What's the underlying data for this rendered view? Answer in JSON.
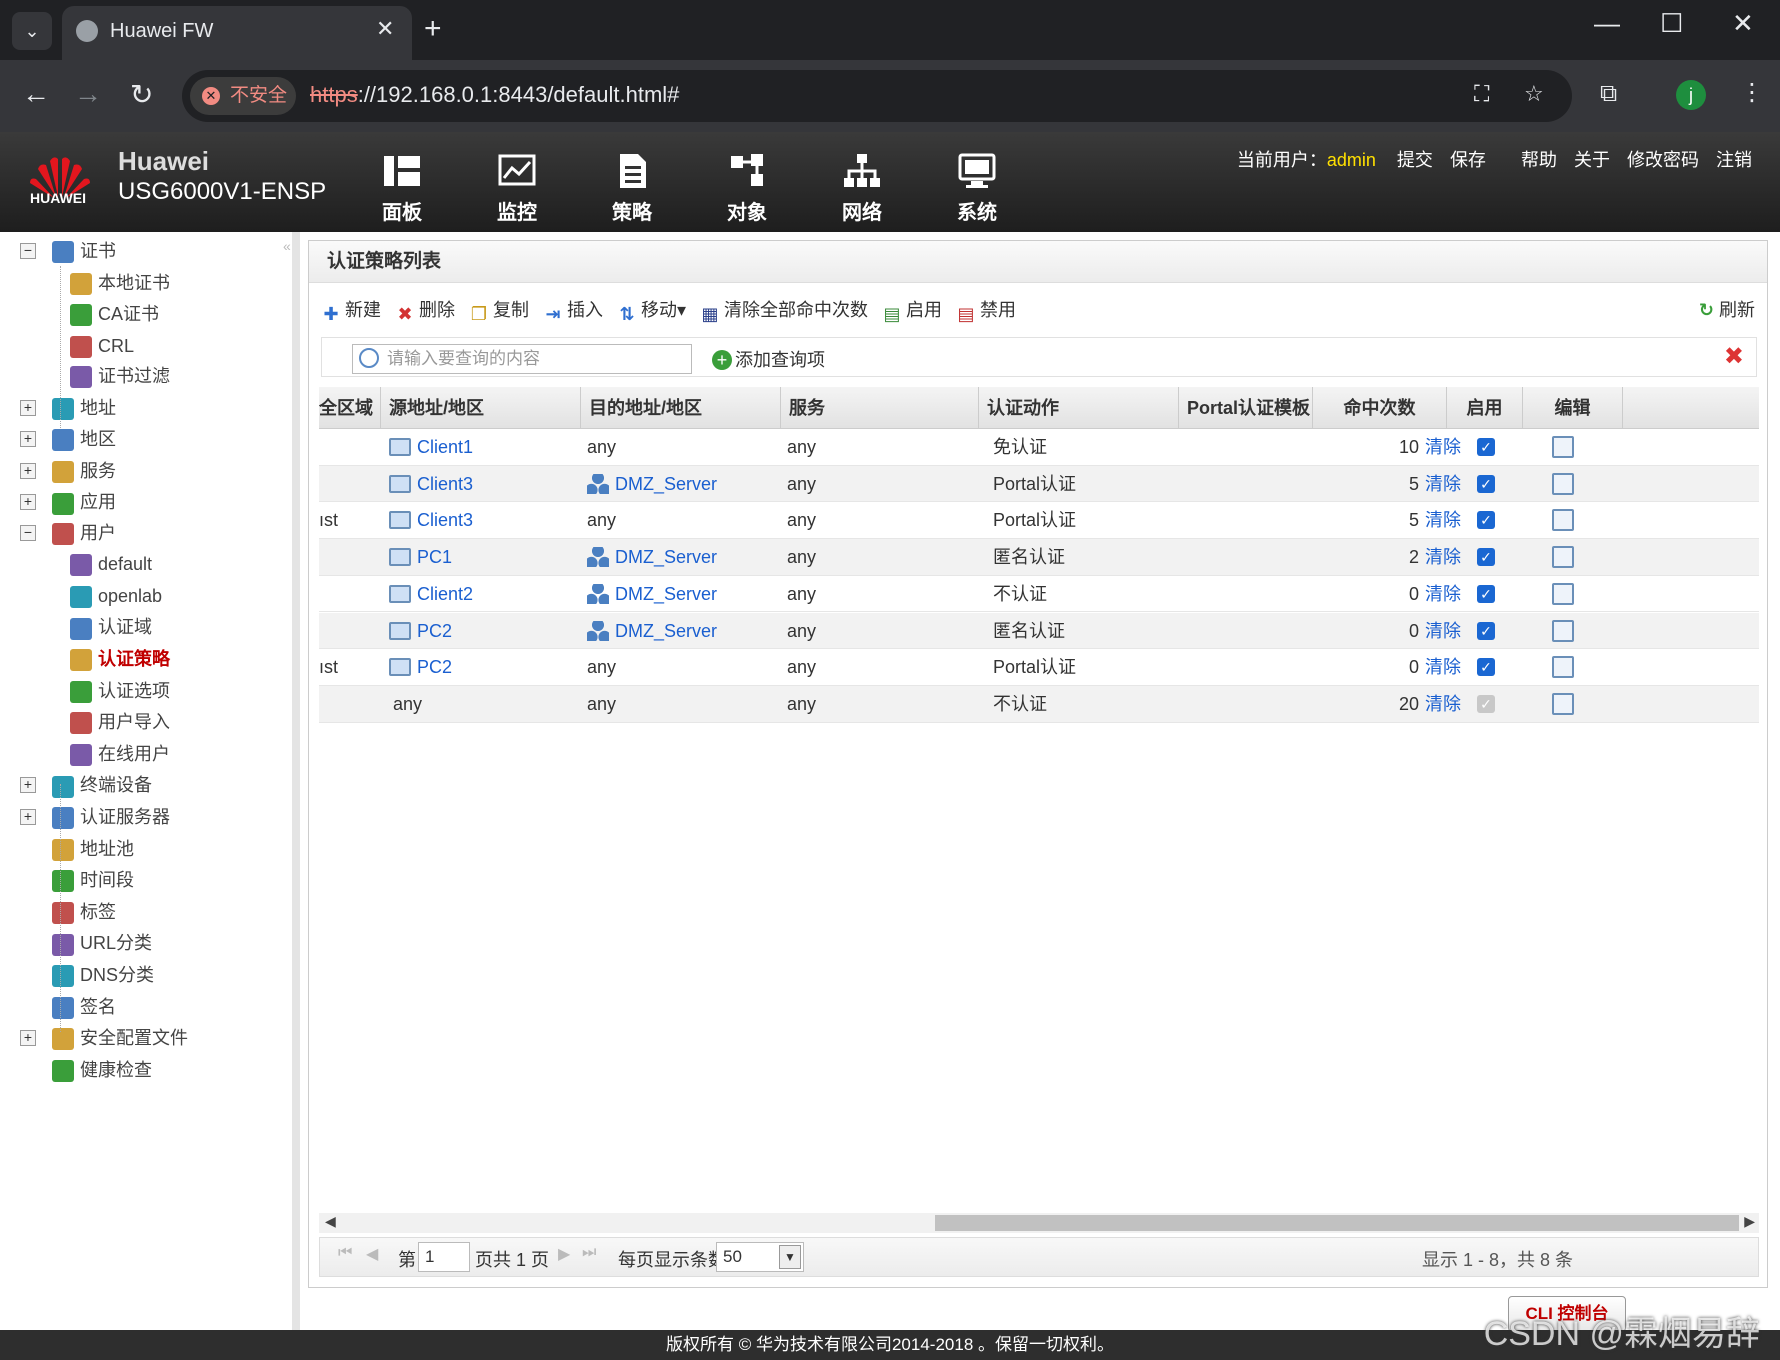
{
  "browser": {
    "tab_title": "Huawei FW",
    "tab_close": "✕",
    "new_tab": "+",
    "insecure_label": "不安全",
    "url_scheme": "https",
    "url_rest": "://192.168.0.1:8443/default.html#",
    "profile_initial": "j"
  },
  "header": {
    "brand_line1": "Huawei",
    "brand_line2": "USG6000V1-ENSP",
    "logo_text": "HUAWEI",
    "nav": [
      "面板",
      "监控",
      "策略",
      "对象",
      "网络",
      "系统"
    ],
    "user_label": "当前用户：",
    "user_name": "admin",
    "links": [
      "提交",
      "保存",
      "帮助",
      "关于",
      "修改密码",
      "注销"
    ]
  },
  "sidebar": {
    "items": [
      {
        "label": "证书",
        "icon": "certificate-icon",
        "level": 0,
        "expander": "−"
      },
      {
        "label": "本地证书",
        "icon": "local-cert-icon",
        "level": 1
      },
      {
        "label": "CA证书",
        "icon": "ca-cert-icon",
        "level": 1
      },
      {
        "label": "CRL",
        "icon": "crl-icon",
        "level": 1
      },
      {
        "label": "证书过滤",
        "icon": "cert-filter-icon",
        "level": 1
      },
      {
        "label": "地址",
        "icon": "address-icon",
        "level": 0,
        "expander": "+"
      },
      {
        "label": "地区",
        "icon": "region-icon",
        "level": 0,
        "expander": "+"
      },
      {
        "label": "服务",
        "icon": "service-icon",
        "level": 0,
        "expander": "+"
      },
      {
        "label": "应用",
        "icon": "application-icon",
        "level": 0,
        "expander": "+"
      },
      {
        "label": "用户",
        "icon": "user-icon",
        "level": 0,
        "expander": "−"
      },
      {
        "label": "default",
        "icon": "user-group-icon",
        "level": 1
      },
      {
        "label": "openlab",
        "icon": "user-group-icon",
        "level": 1
      },
      {
        "label": "认证域",
        "icon": "auth-domain-icon",
        "level": 1
      },
      {
        "label": "认证策略",
        "icon": "auth-policy-icon",
        "level": 1,
        "selected": true
      },
      {
        "label": "认证选项",
        "icon": "auth-option-icon",
        "level": 1
      },
      {
        "label": "用户导入",
        "icon": "user-import-icon",
        "level": 1
      },
      {
        "label": "在线用户",
        "icon": "online-user-icon",
        "level": 1
      },
      {
        "label": "终端设备",
        "icon": "terminal-device-icon",
        "level": 0,
        "expander": "+"
      },
      {
        "label": "认证服务器",
        "icon": "auth-server-icon",
        "level": 0,
        "expander": "+"
      },
      {
        "label": "地址池",
        "icon": "address-pool-icon",
        "level": 0
      },
      {
        "label": "时间段",
        "icon": "time-range-icon",
        "level": 0
      },
      {
        "label": "标签",
        "icon": "tag-icon",
        "level": 0
      },
      {
        "label": "URL分类",
        "icon": "url-category-icon",
        "level": 0
      },
      {
        "label": "DNS分类",
        "icon": "dns-category-icon",
        "level": 0
      },
      {
        "label": "签名",
        "icon": "signature-icon",
        "level": 0
      },
      {
        "label": "安全配置文件",
        "icon": "security-profile-icon",
        "level": 0,
        "expander": "+"
      },
      {
        "label": "健康检查",
        "icon": "health-check-icon",
        "level": 0
      }
    ]
  },
  "panel": {
    "title": "认证策略列表",
    "toolbar": [
      {
        "label": "新建",
        "icon": "add-icon",
        "glyph": "✚",
        "color": "#2f6fd0"
      },
      {
        "label": "删除",
        "icon": "delete-icon",
        "glyph": "✖",
        "color": "#d33333"
      },
      {
        "label": "复制",
        "icon": "copy-icon",
        "glyph": "❐",
        "color": "#c89a1a"
      },
      {
        "label": "插入",
        "icon": "insert-icon",
        "glyph": "⇥",
        "color": "#2f6fd0"
      },
      {
        "label": "移动▾",
        "icon": "move-icon",
        "glyph": "⇅",
        "color": "#2f6fd0"
      },
      {
        "label": "清除全部命中次数",
        "icon": "clear-hits-icon",
        "glyph": "▦",
        "color": "#2a3f8a"
      },
      {
        "label": "启用",
        "icon": "enable-icon",
        "glyph": "▤",
        "color": "#3a8a3a"
      },
      {
        "label": "禁用",
        "icon": "disable-icon",
        "glyph": "▤",
        "color": "#c03030"
      }
    ],
    "refresh_label": "刷新",
    "search_placeholder": "请输入要查询的内容",
    "add_query_label": "添加查询项",
    "columns": [
      "全区域",
      "源地址/地区",
      "目的地址/地区",
      "服务",
      "认证动作",
      "Portal认证模板",
      "命中次数",
      "启用",
      "编辑"
    ],
    "rows": [
      {
        "zone": "",
        "src": "Client1",
        "src_type": "pc",
        "dst": "any",
        "dst_type": "plain",
        "service": "any",
        "action": "免认证",
        "portal": "",
        "hits": "10",
        "clear": "清除",
        "enabled": true,
        "disabled_chk": false
      },
      {
        "zone": "",
        "src": "Client3",
        "src_type": "pc",
        "dst": "DMZ_Server",
        "dst_type": "net",
        "service": "any",
        "action": "Portal认证",
        "portal": "",
        "hits": "5",
        "clear": "清除",
        "enabled": true,
        "disabled_chk": false
      },
      {
        "zone": "ıst",
        "src": "Client3",
        "src_type": "pc",
        "dst": "any",
        "dst_type": "plain",
        "service": "any",
        "action": "Portal认证",
        "portal": "",
        "hits": "5",
        "clear": "清除",
        "enabled": true,
        "disabled_chk": false
      },
      {
        "zone": "",
        "src": "PC1",
        "src_type": "pc",
        "dst": "DMZ_Server",
        "dst_type": "net",
        "service": "any",
        "action": "匿名认证",
        "portal": "",
        "hits": "2",
        "clear": "清除",
        "enabled": true,
        "disabled_chk": false
      },
      {
        "zone": "",
        "src": "Client2",
        "src_type": "pc",
        "dst": "DMZ_Server",
        "dst_type": "net",
        "service": "any",
        "action": "不认证",
        "portal": "",
        "hits": "0",
        "clear": "清除",
        "enabled": true,
        "disabled_chk": false
      },
      {
        "zone": "",
        "src": "PC2",
        "src_type": "pc",
        "dst": "DMZ_Server",
        "dst_type": "net",
        "service": "any",
        "action": "匿名认证",
        "portal": "",
        "hits": "0",
        "clear": "清除",
        "enabled": true,
        "disabled_chk": false
      },
      {
        "zone": "ıst",
        "src": "PC2",
        "src_type": "pc",
        "dst": "any",
        "dst_type": "plain",
        "service": "any",
        "action": "Portal认证",
        "portal": "",
        "hits": "0",
        "clear": "清除",
        "enabled": true,
        "disabled_chk": false
      },
      {
        "zone": "",
        "src": "any",
        "src_type": "plain",
        "dst": "any",
        "dst_type": "plain",
        "service": "any",
        "action": "不认证",
        "portal": "",
        "hits": "20",
        "clear": "清除",
        "enabled": true,
        "disabled_chk": true
      }
    ]
  },
  "pager": {
    "page_prefix": "第",
    "page_value": "1",
    "page_suffix": "页共 1 页",
    "per_page_label": "每页显示条数",
    "per_page_value": "50",
    "summary": "显示 1 - 8，共 8 条"
  },
  "cli_button": "CLI 控制台",
  "footer": "版权所有 © 华为技术有限公司2014-2018 。保留一切权利。",
  "watermark": "CSDN @霖烟易辞"
}
